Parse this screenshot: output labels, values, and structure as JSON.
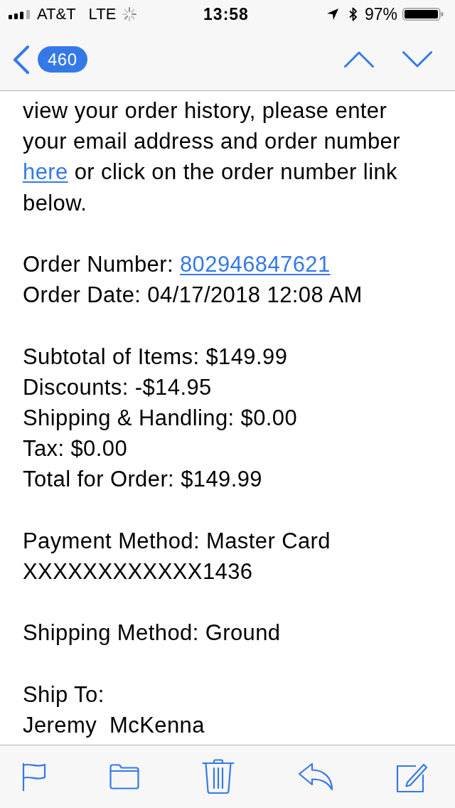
{
  "status_bar": {
    "carrier": "AT&T",
    "network": "LTE",
    "time": "13:58",
    "battery": "97%"
  },
  "nav_bar": {
    "unread_count": "460"
  },
  "email_body": {
    "paragraph": {
      "lines": [
        [
          {
            "kind": "text",
            "text": "view your order history, please enter"
          }
        ],
        [
          {
            "kind": "text",
            "text": "your email address and order number"
          }
        ],
        [
          {
            "kind": "link",
            "text": "here"
          },
          {
            "kind": "text",
            "text": "or click on the order number link"
          }
        ],
        [
          {
            "kind": "text",
            "text": "below."
          }
        ]
      ]
    },
    "detail_groups": [
      [
        [
          {
            "kind": "text",
            "text": "Order Number:"
          },
          {
            "kind": "link",
            "text": "802946847621"
          }
        ],
        [
          {
            "kind": "text",
            "text": "Order Date: 04/17/2018 12:08 AM"
          }
        ]
      ],
      [
        [
          {
            "kind": "text",
            "text": "Subtotal of Items: $149.99"
          }
        ],
        [
          {
            "kind": "text",
            "text": "Discounts: -$14.95"
          }
        ],
        [
          {
            "kind": "text",
            "text": "Shipping & Handling: $0.00"
          }
        ],
        [
          {
            "kind": "text",
            "text": "Tax: $0.00"
          }
        ],
        [
          {
            "kind": "text",
            "text": "Total for Order: $149.99"
          }
        ]
      ],
      [
        [
          {
            "kind": "text",
            "text": "Payment Method: Master Card"
          }
        ],
        [
          {
            "kind": "text",
            "text": "XXXXXXXXXXXX1436"
          }
        ]
      ],
      [
        [
          {
            "kind": "text",
            "text": "Shipping Method: Ground"
          }
        ]
      ],
      [
        [
          {
            "kind": "text",
            "text": "Ship To:"
          }
        ],
        [
          {
            "kind": "text",
            "text": "Jeremy  McKenna"
          }
        ]
      ]
    ]
  }
}
